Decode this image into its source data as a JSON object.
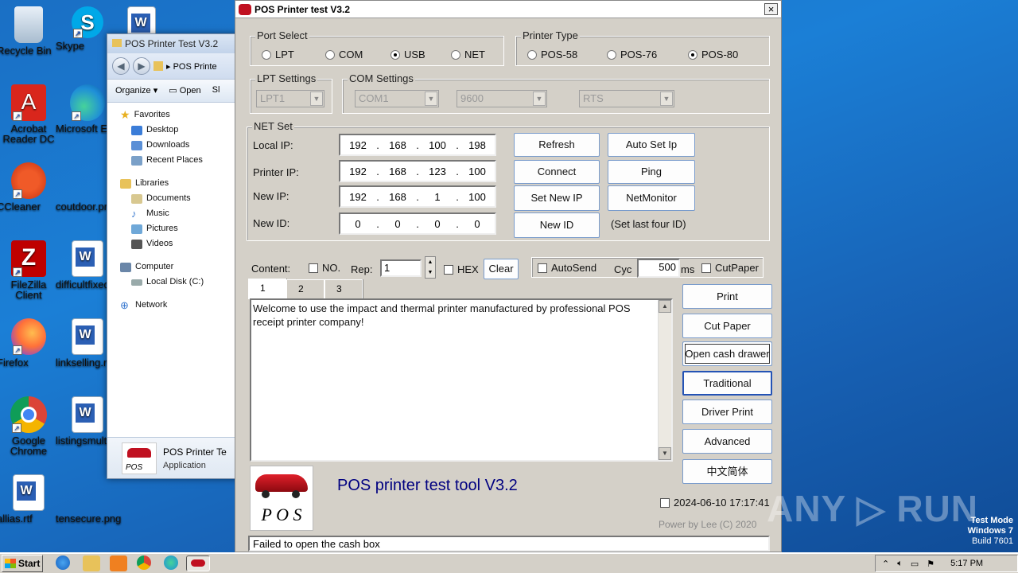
{
  "desktop": {
    "icons": [
      {
        "label": "Recycle Bin"
      },
      {
        "label": "Skype"
      },
      {
        "label": "Acrobat Reader DC"
      },
      {
        "label": "Microsoft Ed"
      },
      {
        "label": "CCleaner"
      },
      {
        "label": "coutdoor.pr"
      },
      {
        "label": "FileZilla Client"
      },
      {
        "label": "difficultfixed"
      },
      {
        "label": "Firefox"
      },
      {
        "label": "linkselling.r"
      },
      {
        "label": "Google Chrome"
      },
      {
        "label": "listingsmulti"
      },
      {
        "label": "allias.rtf"
      },
      {
        "label": "tensecure.png"
      }
    ]
  },
  "explorer": {
    "title": "POS Printer Test V3.2",
    "address": "POS Printe",
    "organize": "Organize",
    "open": "Open",
    "more": "Sl",
    "nav": {
      "favorites": "Favorites",
      "desktop": "Desktop",
      "downloads": "Downloads",
      "recent": "Recent Places",
      "libraries": "Libraries",
      "documents": "Documents",
      "music": "Music",
      "pictures": "Pictures",
      "videos": "Videos",
      "computer": "Computer",
      "localdisk": "Local Disk (C:)",
      "network": "Network"
    },
    "details_name": "POS Printer Te",
    "details_type": "Application"
  },
  "pos": {
    "title": "POS Printer test V3.2",
    "close": "×",
    "port_select": {
      "caption": "Port Select",
      "options": [
        "LPT",
        "COM",
        "USB",
        "NET"
      ],
      "selected": "USB"
    },
    "printer_type": {
      "caption": "Printer Type",
      "options": [
        "POS-58",
        "POS-76",
        "POS-80"
      ],
      "selected": "POS-80"
    },
    "lpt_settings": {
      "caption": "LPT Settings",
      "value": "LPT1"
    },
    "com_settings": {
      "caption": "COM Settings",
      "port": "COM1",
      "baud": "9600",
      "flow": "RTS"
    },
    "net_set": {
      "caption": "NET Set",
      "local_ip_label": "Local IP:",
      "local_ip": [
        "192",
        "168",
        "100",
        "198"
      ],
      "printer_ip_label": "Printer IP:",
      "printer_ip": [
        "192",
        "168",
        "123",
        "100"
      ],
      "new_ip_label": "New IP:",
      "new_ip": [
        "192",
        "168",
        "1",
        "100"
      ],
      "new_id_label": "New ID:",
      "new_id": [
        "0",
        "0",
        "0",
        "0"
      ],
      "refresh": "Refresh",
      "auto_set_ip": "Auto Set Ip",
      "connect": "Connect",
      "ping": "Ping",
      "set_new_ip": "Set New IP",
      "net_monitor": "NetMonitor",
      "new_id_btn": "New ID",
      "hint": "(Set last four ID)"
    },
    "content_row": {
      "content": "Content:",
      "no": "NO.",
      "rep": "Rep:",
      "rep_value": "1",
      "hex": "HEX",
      "clear": "Clear",
      "autosend": "AutoSend",
      "cyc": "Cyc",
      "cyc_value": "500",
      "ms": "ms",
      "cutpaper": "CutPaper"
    },
    "tabs": [
      "1",
      "2",
      "3"
    ],
    "text": "Welcome to use the impact and thermal printer manufactured by professional POS receipt printer company!",
    "side_buttons": {
      "print": "Print",
      "cut_paper": "Cut Paper",
      "open_cash_drawer": "Open cash drawer",
      "traditional": "Traditional",
      "driver_print": "Driver Print",
      "advanced": "Advanced",
      "chinese": "中文简体"
    },
    "logo_text": "P O S",
    "tool_title": "POS printer test tool V3.2",
    "datetime": "2024-06-10 17:17:41",
    "power_by": "Power by Lee (C) 2020",
    "status": "Failed to open the cash box"
  },
  "taskbar": {
    "start": "Start",
    "clock": "5:17 PM"
  },
  "watermark": "ANY ▷ RUN",
  "testmode": {
    "line1": "Test Mode",
    "line2": "Windows 7",
    "line3": "Build 7601"
  }
}
